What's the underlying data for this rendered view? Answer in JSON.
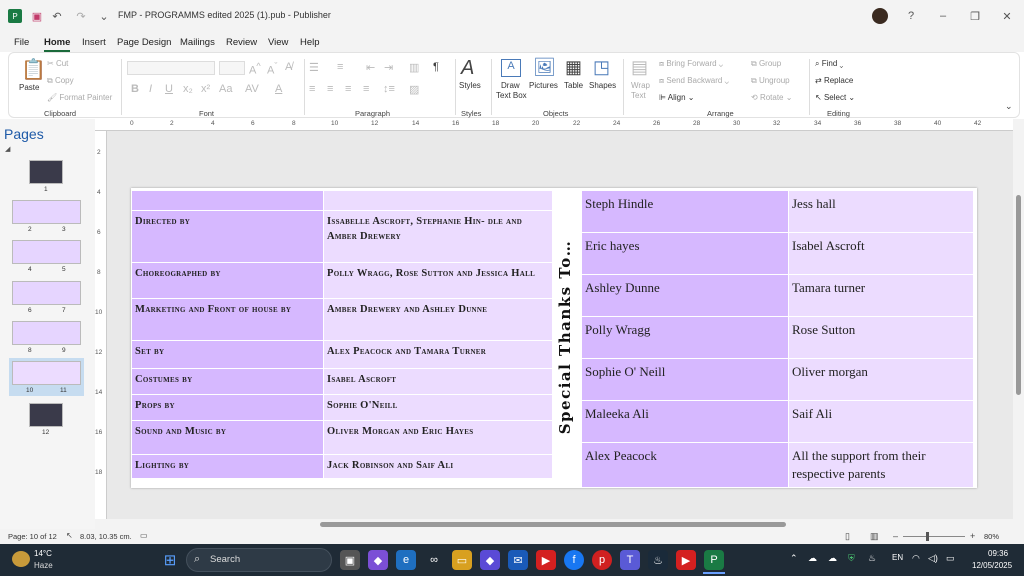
{
  "window": {
    "title": "FMP - PROGRAMMS edited 2025 (1).pub  -  Publisher"
  },
  "menu": [
    "File",
    "Home",
    "Insert",
    "Page Design",
    "Mailings",
    "Review",
    "View",
    "Help"
  ],
  "ribbon": {
    "clipboard": {
      "paste": "Paste",
      "cut": "Cut",
      "copy": "Copy",
      "format_painter": "Format Painter",
      "label": "Clipboard"
    },
    "font": {
      "label": "Font"
    },
    "paragraph": {
      "label": "Paragraph"
    },
    "styles": {
      "styles": "Styles",
      "label": "Styles"
    },
    "objects": {
      "draw_text_box": "Draw",
      "draw_text_box2": "Text Box",
      "pictures": "Pictures",
      "table": "Table",
      "shapes": "Shapes",
      "label": "Objects"
    },
    "arrange": {
      "wrap_text": "Wrap",
      "wrap_text2": "Text",
      "bring_forward": "Bring Forward",
      "send_backward": "Send Backward",
      "align": "Align",
      "group": "Group",
      "ungroup": "Ungroup",
      "rotate": "Rotate",
      "label": "Arrange"
    },
    "editing": {
      "find": "Find",
      "replace": "Replace",
      "select": "Select",
      "label": "Editing"
    }
  },
  "pages_pane": {
    "title": "Pages",
    "numbers": [
      "1",
      "2",
      "3",
      "4",
      "5",
      "6",
      "7",
      "8",
      "9",
      "10",
      "11",
      "12"
    ]
  },
  "ruler": {
    "h": [
      "0",
      "2",
      "4",
      "6",
      "8",
      "10",
      "12",
      "14",
      "16",
      "18",
      "20",
      "22",
      "24",
      "26",
      "28",
      "30",
      "32",
      "34",
      "36",
      "38",
      "40",
      "42"
    ],
    "v": [
      "2",
      "4",
      "6",
      "8",
      "10",
      "12",
      "14",
      "16",
      "18"
    ]
  },
  "credits": [
    {
      "role": "",
      "names": ""
    },
    {
      "role": "Directed by",
      "names": "Issabelle Ascroft, Stephanie Hin- dle and Amber Drewery"
    },
    {
      "role": "Choreographed by",
      "names": "Polly Wragg, Rose Sutton and Jessica Hall"
    },
    {
      "role": "Marketing and Front of house by",
      "names": "Amber Drewery and Ashley Dunne"
    },
    {
      "role": "Set by",
      "names": "Alex Peacock and Tamara Turner"
    },
    {
      "role": "Costumes by",
      "names": "Isabel Ascroft"
    },
    {
      "role": "Props by",
      "names": "Sophie O'Neill"
    },
    {
      "role": "Sound and Music by",
      "names": "Oliver Morgan and Eric Hayes"
    },
    {
      "role": "Lighting by",
      "names": "Jack Robinson and Saif Ali"
    }
  ],
  "special_thanks": {
    "heading": "Special Thanks To…",
    "rows": [
      [
        "Steph Hindle",
        "Jess hall"
      ],
      [
        "Eric hayes",
        "Isabel Ascroft"
      ],
      [
        "Ashley Dunne",
        "Tamara turner"
      ],
      [
        "Polly Wragg",
        "Rose Sutton"
      ],
      [
        "Sophie O' Neill",
        "Oliver morgan"
      ],
      [
        "Maleeka Ali",
        "Saif Ali"
      ],
      [
        "Alex Peacock",
        "All the support from their respective parents"
      ]
    ]
  },
  "status": {
    "page": "Page: 10 of 12",
    "position": "8.03, 10.35 cm.",
    "zoom": "80%"
  },
  "taskbar": {
    "temp": "14°C",
    "condition": "Haze",
    "search": "Search",
    "time": "09:36",
    "date": "12/05/2025"
  }
}
